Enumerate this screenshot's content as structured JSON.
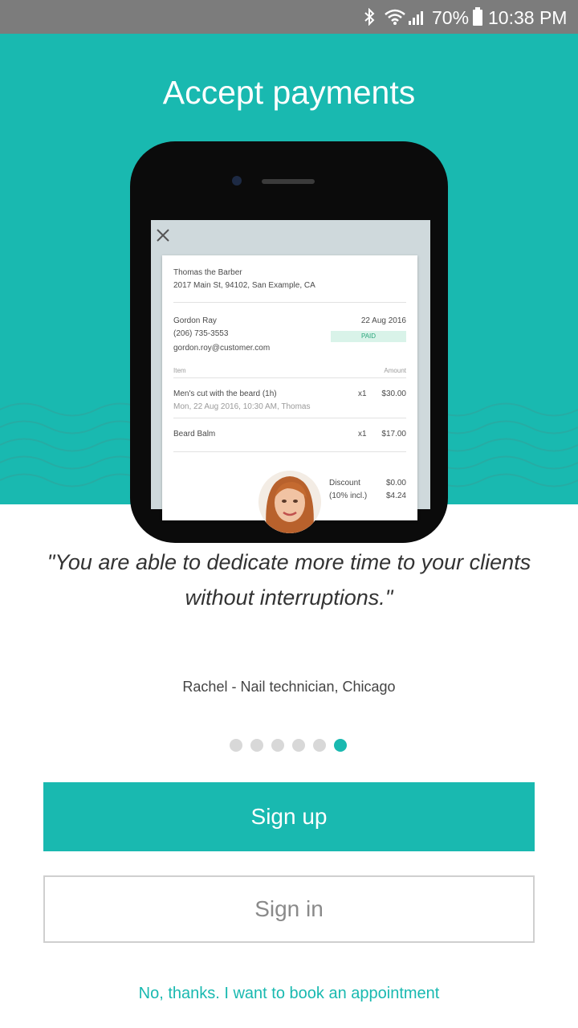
{
  "status_bar": {
    "battery": "70%",
    "time": "10:38 PM"
  },
  "hero": {
    "title": "Accept payments",
    "background_color": "#19b9b0"
  },
  "receipt": {
    "business_name": "Thomas the Barber",
    "business_address": "2017 Main St, 94102, San Example, CA",
    "customer_name": "Gordon Ray",
    "customer_phone": "(206) 735-3553",
    "customer_email": "gordon.roy@customer.com",
    "date": "22 Aug 2016",
    "status": "PAID",
    "col_item": "Item",
    "col_amount": "Amount",
    "items": [
      {
        "name": "Men's cut with the beard (1h)",
        "detail": "Mon, 22 Aug 2016, 10:30 AM, Thomas",
        "qty": "x1",
        "price": "$30.00"
      },
      {
        "name": "Beard Balm",
        "detail": "",
        "qty": "x1",
        "price": "$17.00"
      }
    ],
    "discount_label": "Discount",
    "discount_value": "$0.00",
    "tax_label": "(10% incl.)",
    "tax_value": "$4.24"
  },
  "testimonial": {
    "quote": "\"You are able to dedicate more time to your clients without interruptions.\"",
    "author": "Rachel - Nail technician, Chicago"
  },
  "page_indicator": {
    "total": 6,
    "active": 6
  },
  "actions": {
    "signup_label": "Sign up",
    "signin_label": "Sign in",
    "skip_label": "No, thanks. I want to book an appointment"
  }
}
